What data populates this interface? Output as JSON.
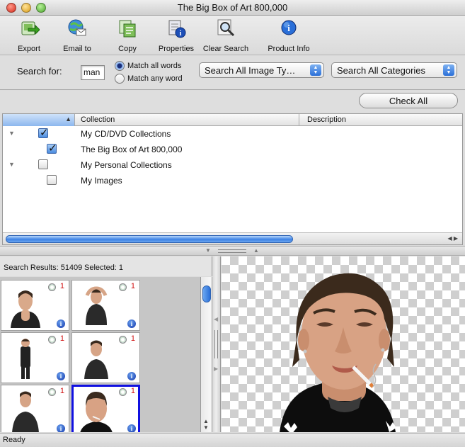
{
  "window": {
    "title": "The Big Box of Art 800,000"
  },
  "toolbar": {
    "export_label": "Export",
    "email_label": "Email to",
    "copy_label": "Copy",
    "properties_label": "Properties",
    "clear_search_label": "Clear Search",
    "product_info_label": "Product Info"
  },
  "search": {
    "label": "Search for:",
    "query": "man",
    "match_all_label": "Match all words",
    "match_any_label": "Match any word",
    "match_mode": "all",
    "image_type_value": "Search All Image Ty…",
    "category_value": "Search All Categories"
  },
  "check_all_label": "Check All",
  "collections": {
    "columns": {
      "collection": "Collection",
      "description": "Description"
    },
    "rows": [
      {
        "label": "My CD/DVD Collections",
        "checked": true,
        "expanded": true
      },
      {
        "label": "The Big Box of Art 800,000",
        "checked": true
      },
      {
        "label": "My Personal Collections",
        "checked": false,
        "expanded": true
      },
      {
        "label": "My Images",
        "checked": false
      }
    ]
  },
  "results": {
    "summary": "Search Results: 51409",
    "selected": "Selected: 1",
    "thumbnails": [
      {
        "count": "1",
        "selected": false,
        "icon": "disc-icon"
      },
      {
        "count": "1",
        "selected": false,
        "icon": "disc-icon"
      },
      {
        "count": "1",
        "selected": false,
        "icon": "disc-icon"
      },
      {
        "count": "1",
        "selected": false,
        "icon": "disc-icon"
      },
      {
        "count": "1",
        "selected": false,
        "icon": "disc-icon"
      },
      {
        "count": "1",
        "selected": true,
        "icon": "disc-icon"
      }
    ]
  },
  "status": {
    "text": "Ready"
  },
  "colors": {
    "accent": "#2a6fd8",
    "selection_border": "#1010e0",
    "count_red": "#d01010"
  }
}
